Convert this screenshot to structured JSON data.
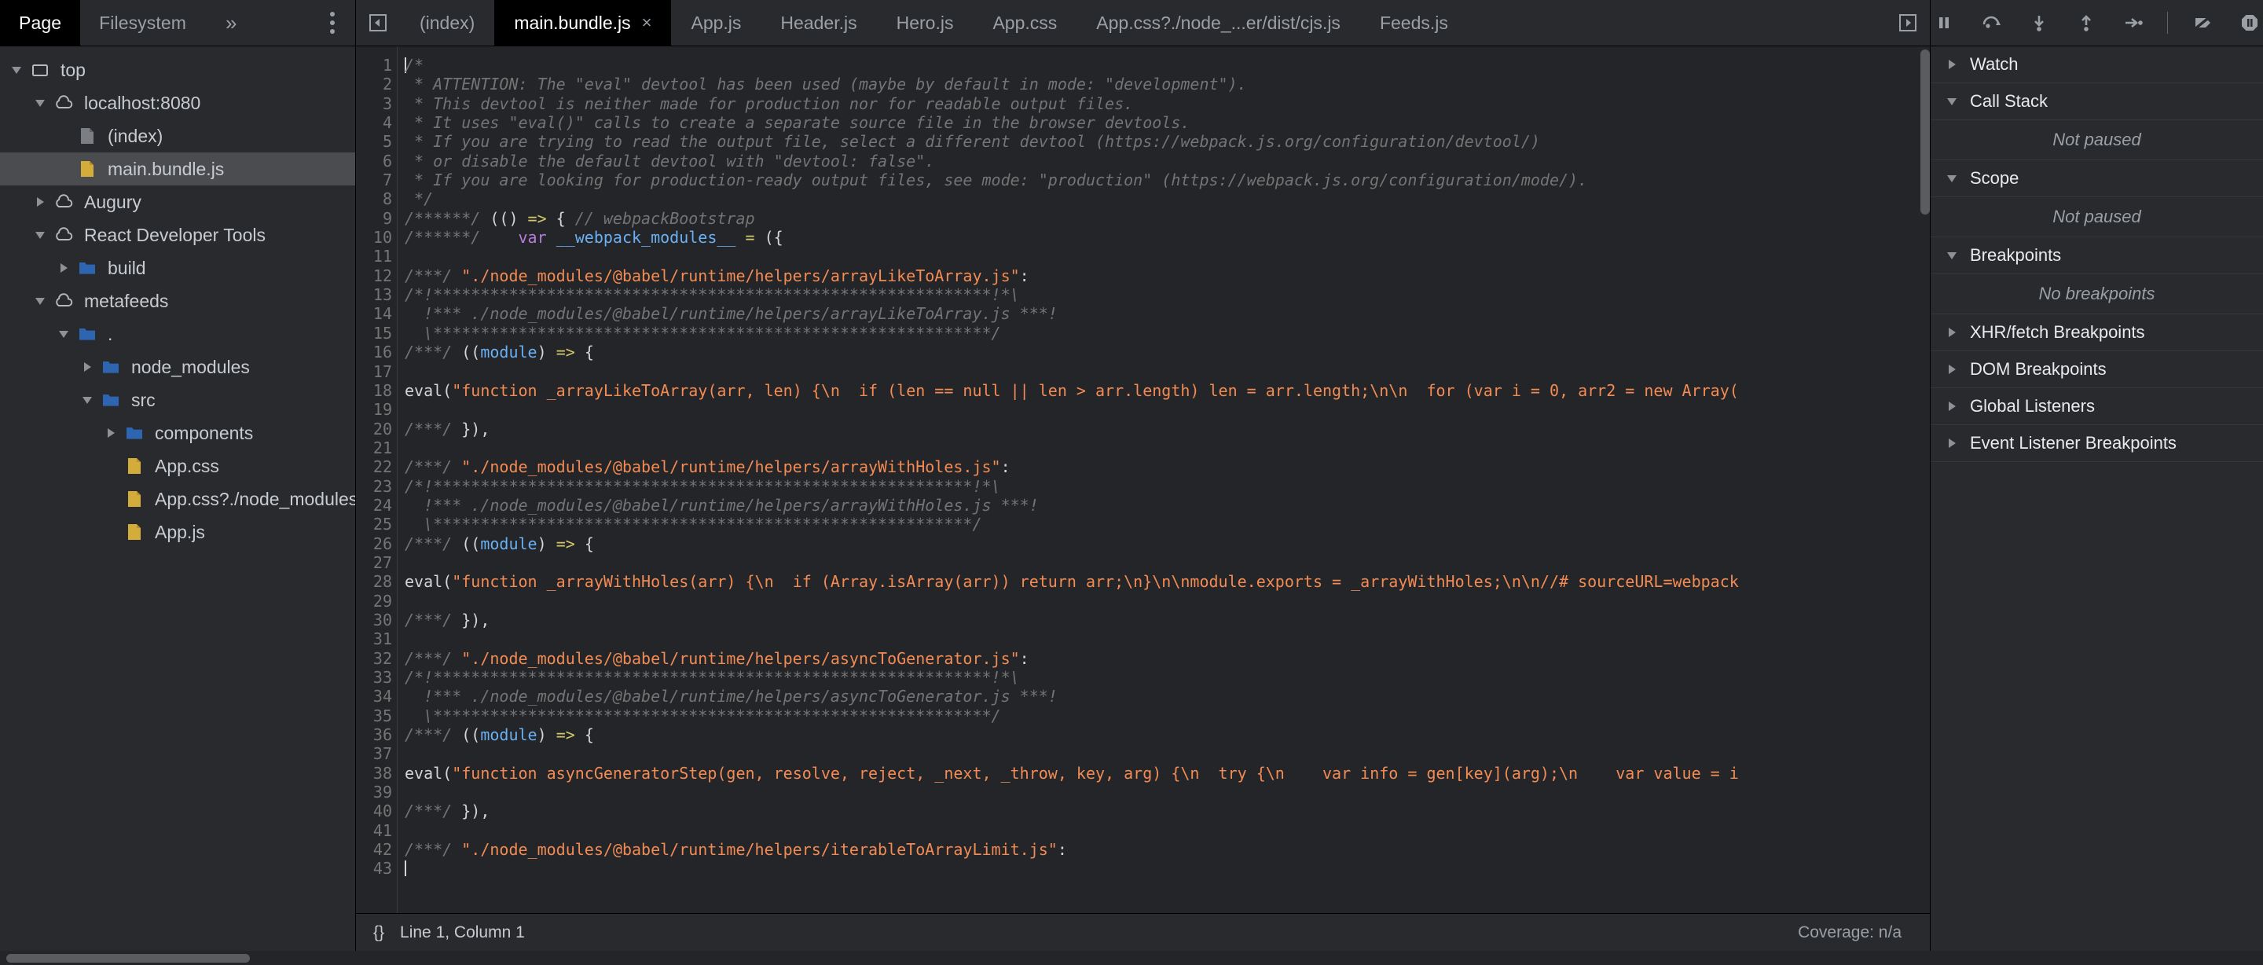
{
  "navigator": {
    "tabs": [
      {
        "label": "Page",
        "selected": true
      },
      {
        "label": "Filesystem",
        "selected": false
      }
    ],
    "more_label": "»",
    "tree": [
      {
        "label": "top",
        "depth": 0,
        "twisty": "down",
        "icon": "frame",
        "selected": false
      },
      {
        "label": "localhost:8080",
        "depth": 1,
        "twisty": "down",
        "icon": "cloud",
        "selected": false
      },
      {
        "label": "(index)",
        "depth": 2,
        "twisty": "none",
        "icon": "file-gray",
        "selected": false
      },
      {
        "label": "main.bundle.js",
        "depth": 2,
        "twisty": "none",
        "icon": "file-yellow",
        "selected": true
      },
      {
        "label": "Augury",
        "depth": 1,
        "twisty": "right",
        "icon": "cloud",
        "selected": false
      },
      {
        "label": "React Developer Tools",
        "depth": 1,
        "twisty": "down",
        "icon": "cloud",
        "selected": false
      },
      {
        "label": "build",
        "depth": 2,
        "twisty": "right",
        "icon": "folder",
        "selected": false
      },
      {
        "label": "metafeeds",
        "depth": 1,
        "twisty": "down",
        "icon": "cloud",
        "selected": false
      },
      {
        "label": ".",
        "depth": 2,
        "twisty": "down",
        "icon": "folder",
        "selected": false
      },
      {
        "label": "node_modules",
        "depth": 3,
        "twisty": "right",
        "icon": "folder",
        "selected": false
      },
      {
        "label": "src",
        "depth": 3,
        "twisty": "down",
        "icon": "folder",
        "selected": false
      },
      {
        "label": "components",
        "depth": 4,
        "twisty": "right",
        "icon": "folder",
        "selected": false
      },
      {
        "label": "App.css",
        "depth": 4,
        "twisty": "none",
        "icon": "file-yellow",
        "selected": false
      },
      {
        "label": "App.css?./node_modules/",
        "depth": 4,
        "twisty": "none",
        "icon": "file-yellow",
        "selected": false
      },
      {
        "label": "App.js",
        "depth": 4,
        "twisty": "none",
        "icon": "file-yellow",
        "selected": false
      }
    ]
  },
  "editor": {
    "tabs": [
      {
        "label": "(index)",
        "active": false,
        "closable": false
      },
      {
        "label": "main.bundle.js",
        "active": true,
        "closable": true
      },
      {
        "label": "App.js",
        "active": false,
        "closable": false
      },
      {
        "label": "Header.js",
        "active": false,
        "closable": false
      },
      {
        "label": "Hero.js",
        "active": false,
        "closable": false
      },
      {
        "label": "App.css",
        "active": false,
        "closable": false
      },
      {
        "label": "App.css?./node_...er/dist/cjs.js",
        "active": false,
        "closable": false
      },
      {
        "label": "Feeds.js",
        "active": false,
        "closable": false
      }
    ],
    "close_glyph": "×",
    "first_line": 1,
    "lines": [
      [
        {
          "t": "caret",
          "v": ""
        },
        {
          "t": "cm",
          "v": "/*"
        }
      ],
      [
        {
          "t": "cm",
          "v": " * ATTENTION: The \"eval\" devtool has been used (maybe by default in mode: \"development\")."
        }
      ],
      [
        {
          "t": "cm",
          "v": " * This devtool is neither made for production nor for readable output files."
        }
      ],
      [
        {
          "t": "cm",
          "v": " * It uses \"eval()\" calls to create a separate source file in the browser devtools."
        }
      ],
      [
        {
          "t": "cm",
          "v": " * If you are trying to read the output file, select a different devtool (https://webpack.js.org/configuration/devtool/)"
        }
      ],
      [
        {
          "t": "cm",
          "v": " * or disable the default devtool with \"devtool: false\"."
        }
      ],
      [
        {
          "t": "cm",
          "v": " * If you are looking for production-ready output files, see mode: \"production\" (https://webpack.js.org/configuration/mode/)."
        }
      ],
      [
        {
          "t": "cm",
          "v": " */"
        }
      ],
      [
        {
          "t": "cm",
          "v": "/******/ "
        },
        {
          "t": "pl",
          "v": "(() "
        },
        {
          "t": "op",
          "v": "=>"
        },
        {
          "t": "pl",
          "v": " { "
        },
        {
          "t": "cm",
          "v": "// webpackBootstrap"
        }
      ],
      [
        {
          "t": "cm",
          "v": "/******/ "
        },
        {
          "t": "pl",
          "v": "   "
        },
        {
          "t": "kw",
          "v": "var"
        },
        {
          "t": "pl",
          "v": " "
        },
        {
          "t": "id",
          "v": "__webpack_modules__"
        },
        {
          "t": "pl",
          "v": " "
        },
        {
          "t": "op",
          "v": "="
        },
        {
          "t": "pl",
          "v": " ({"
        }
      ],
      [],
      [
        {
          "t": "cm",
          "v": "/***/ "
        },
        {
          "t": "str",
          "v": "\"./node_modules/@babel/runtime/helpers/arrayLikeToArray.js\""
        },
        {
          "t": "pl",
          "v": ":"
        }
      ],
      [
        {
          "t": "cm",
          "v": "/*!***********************************************************!*\\"
        }
      ],
      [
        {
          "t": "cm",
          "v": "  !*** ./node_modules/@babel/runtime/helpers/arrayLikeToArray.js ***!"
        }
      ],
      [
        {
          "t": "cm",
          "v": "  \\***********************************************************/"
        }
      ],
      [
        {
          "t": "cm",
          "v": "/***/ "
        },
        {
          "t": "pl",
          "v": "(("
        },
        {
          "t": "id",
          "v": "module"
        },
        {
          "t": "pl",
          "v": ") "
        },
        {
          "t": "op",
          "v": "=>"
        },
        {
          "t": "pl",
          "v": " {"
        }
      ],
      [],
      [
        {
          "t": "pl",
          "v": "eval("
        },
        {
          "t": "str",
          "v": "\"function _arrayLikeToArray(arr, len) {\\n  if (len == null || len > arr.length) len = arr.length;\\n\\n  for (var i = 0, arr2 = new Array("
        }
      ],
      [],
      [
        {
          "t": "cm",
          "v": "/***/ "
        },
        {
          "t": "pl",
          "v": "}),"
        }
      ],
      [],
      [
        {
          "t": "cm",
          "v": "/***/ "
        },
        {
          "t": "str",
          "v": "\"./node_modules/@babel/runtime/helpers/arrayWithHoles.js\""
        },
        {
          "t": "pl",
          "v": ":"
        }
      ],
      [
        {
          "t": "cm",
          "v": "/*!*********************************************************!*\\"
        }
      ],
      [
        {
          "t": "cm",
          "v": "  !*** ./node_modules/@babel/runtime/helpers/arrayWithHoles.js ***!"
        }
      ],
      [
        {
          "t": "cm",
          "v": "  \\*********************************************************/"
        }
      ],
      [
        {
          "t": "cm",
          "v": "/***/ "
        },
        {
          "t": "pl",
          "v": "(("
        },
        {
          "t": "id",
          "v": "module"
        },
        {
          "t": "pl",
          "v": ") "
        },
        {
          "t": "op",
          "v": "=>"
        },
        {
          "t": "pl",
          "v": " {"
        }
      ],
      [],
      [
        {
          "t": "pl",
          "v": "eval("
        },
        {
          "t": "str",
          "v": "\"function _arrayWithHoles(arr) {\\n  if (Array.isArray(arr)) return arr;\\n}\\n\\nmodule.exports = _arrayWithHoles;\\n\\n//# sourceURL=webpack"
        }
      ],
      [],
      [
        {
          "t": "cm",
          "v": "/***/ "
        },
        {
          "t": "pl",
          "v": "}),"
        }
      ],
      [],
      [
        {
          "t": "cm",
          "v": "/***/ "
        },
        {
          "t": "str",
          "v": "\"./node_modules/@babel/runtime/helpers/asyncToGenerator.js\""
        },
        {
          "t": "pl",
          "v": ":"
        }
      ],
      [
        {
          "t": "cm",
          "v": "/*!***********************************************************!*\\"
        }
      ],
      [
        {
          "t": "cm",
          "v": "  !*** ./node_modules/@babel/runtime/helpers/asyncToGenerator.js ***!"
        }
      ],
      [
        {
          "t": "cm",
          "v": "  \\***********************************************************/"
        }
      ],
      [
        {
          "t": "cm",
          "v": "/***/ "
        },
        {
          "t": "pl",
          "v": "(("
        },
        {
          "t": "id",
          "v": "module"
        },
        {
          "t": "pl",
          "v": ") "
        },
        {
          "t": "op",
          "v": "=>"
        },
        {
          "t": "pl",
          "v": " {"
        }
      ],
      [],
      [
        {
          "t": "pl",
          "v": "eval("
        },
        {
          "t": "str",
          "v": "\"function asyncGeneratorStep(gen, resolve, reject, _next, _throw, key, arg) {\\n  try {\\n    var info = gen[key](arg);\\n    var value = i"
        }
      ],
      [],
      [
        {
          "t": "cm",
          "v": "/***/ "
        },
        {
          "t": "pl",
          "v": "}),"
        }
      ],
      [],
      [
        {
          "t": "cm",
          "v": "/***/ "
        },
        {
          "t": "str",
          "v": "\"./node_modules/@babel/runtime/helpers/iterableToArrayLimit.js\""
        },
        {
          "t": "pl",
          "v": ":"
        }
      ],
      [
        {
          "t": "caret",
          "v": ""
        }
      ]
    ]
  },
  "statusbar": {
    "format_label": "{}",
    "position": "Line 1, Column 1",
    "coverage": "Coverage: n/a"
  },
  "debugger": {
    "toolbar": [
      {
        "name": "resume-button"
      },
      {
        "name": "step-over-button"
      },
      {
        "name": "step-into-button"
      },
      {
        "name": "step-out-button"
      },
      {
        "name": "step-button"
      },
      {
        "name": "separator"
      },
      {
        "name": "deactivate-breakpoints-button"
      },
      {
        "name": "pause-on-exceptions-button"
      }
    ],
    "sections": [
      {
        "title": "Watch",
        "expanded": false,
        "empty": null
      },
      {
        "title": "Call Stack",
        "expanded": true,
        "empty": "Not paused"
      },
      {
        "title": "Scope",
        "expanded": true,
        "empty": "Not paused"
      },
      {
        "title": "Breakpoints",
        "expanded": true,
        "empty": "No breakpoints"
      },
      {
        "title": "XHR/fetch Breakpoints",
        "expanded": false,
        "empty": null
      },
      {
        "title": "DOM Breakpoints",
        "expanded": false,
        "empty": null
      },
      {
        "title": "Global Listeners",
        "expanded": false,
        "empty": null
      },
      {
        "title": "Event Listener Breakpoints",
        "expanded": false,
        "empty": null
      }
    ]
  }
}
